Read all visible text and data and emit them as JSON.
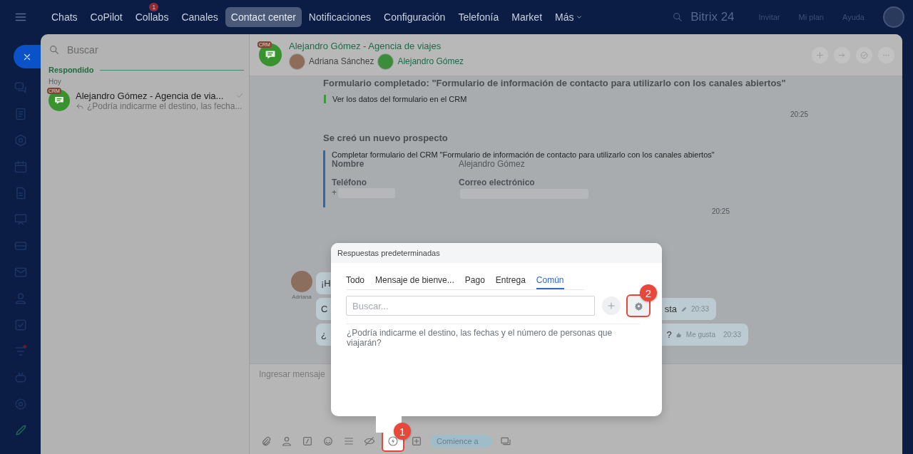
{
  "top_nav": {
    "items": [
      {
        "label": "Chats",
        "selected": false
      },
      {
        "label": "CoPilot",
        "selected": false
      },
      {
        "label": "Collabs",
        "selected": false,
        "badge": "1"
      },
      {
        "label": "Canales",
        "selected": false
      },
      {
        "label": "Contact center",
        "selected": true
      },
      {
        "label": "Notificaciones",
        "selected": false
      },
      {
        "label": "Configuración",
        "selected": false
      },
      {
        "label": "Telefonía",
        "selected": false
      },
      {
        "label": "Market",
        "selected": false
      },
      {
        "label": "Más",
        "selected": false
      }
    ],
    "logo": "Bitrix 24",
    "links": [
      "Invitar",
      "Mi plan",
      "Ayuda"
    ]
  },
  "chat_list": {
    "search_placeholder": "Buscar",
    "group": "Respondido",
    "date": "Hoy",
    "items": [
      {
        "title": "Alejandro Gómez - Agencia de via...",
        "preview": "¿Podría indicarme el destino, las fecha...",
        "badge": "CRM"
      }
    ]
  },
  "chat": {
    "badge": "CRM",
    "title": "Alejandro Gómez - Agencia de viajes",
    "members": [
      "Adriana Sánchez",
      "Alejandro Gómez"
    ],
    "messages": [
      {
        "kind": "form",
        "title": "Formulario completado: \"Formulario de información de contacto para utilizarlo con los canales abiertos\"",
        "link": "Ver los datos del formulario en el CRM",
        "time": "20:25"
      },
      {
        "kind": "lead",
        "title": "Se creó un nuevo prospecto",
        "description": "Completar formulario del CRM \"Formulario de información de contacto para utilizarlo con los canales abiertos\"",
        "fields": [
          {
            "label": "Nombre",
            "value": "Alejandro Gómez"
          },
          {
            "label": "Teléfono",
            "value": "+",
            "redacted": true
          },
          {
            "label": "Correo electrónico",
            "redacted": true
          }
        ],
        "time": "20:25"
      },
      {
        "kind": "bubbles",
        "author": "Adriana",
        "bubbles": [
          {
            "text": "¡H"
          },
          {
            "text": "C",
            "tail": "sta",
            "edited": true,
            "time": "20:33"
          },
          {
            "text": "¿",
            "tail": "?",
            "like": "Me gusta",
            "time": "20:33"
          }
        ]
      }
    ],
    "composer": {
      "placeholder": "Ingresar mensaje",
      "pill": "Comience a"
    }
  },
  "popup": {
    "title": "Respuestas predeterminadas",
    "tabs": [
      {
        "label": "Todo",
        "selected": false
      },
      {
        "label": "Mensaje de bienve...",
        "selected": false
      },
      {
        "label": "Pago",
        "selected": false
      },
      {
        "label": "Entrega",
        "selected": false
      },
      {
        "label": "Común",
        "selected": true
      }
    ],
    "search_placeholder": "Buscar...",
    "responses": [
      "¿Podría indicarme el destino, las fechas y el número de personas que viajarán?"
    ]
  },
  "annotations": [
    {
      "label": "1"
    },
    {
      "label": "2"
    }
  ]
}
